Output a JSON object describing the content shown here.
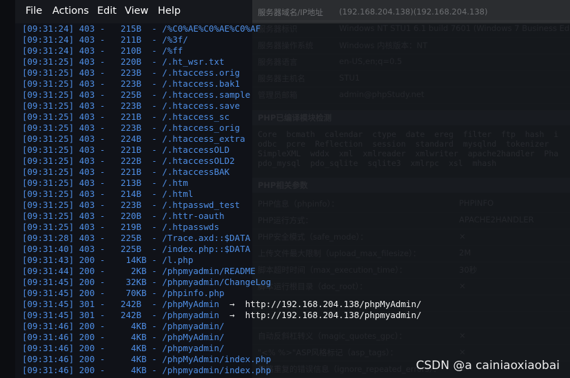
{
  "menu": [
    "File",
    "Actions",
    "Edit",
    "View",
    "Help"
  ],
  "bg_page": {
    "rows": [
      {
        "k": "服务器域名/IP地址",
        "v": "(192.168.204.138)(192.168.204.138)"
      },
      {
        "k": "服务器标识",
        "v": "Windows NT STU1 6.1 build 7601 (Windows 7 Business Edition"
      },
      {
        "k": "服务器操作系统",
        "v": "Windows  内核版本：NT"
      },
      {
        "k": "服务器语言",
        "v": "en-US,en;q=0.5"
      },
      {
        "k": "服务器主机名",
        "v": "STU1"
      },
      {
        "k": "管理员邮箱",
        "v": "admin@phpStudy.net"
      }
    ],
    "section1": "PHP已编译模块检测",
    "modules": "Core  bcmath  calendar  ctype  date  ereg  filter  ftp  hash  i\nodbc  pcre  Reflection  session  standard  mysqlnd  tokenizer  \nSimpleXML  wddx  xml  xmlreader  xmlwriter  apache2handler  Pha\npdo_mysql  pdo_sqlite  sqlite3  xmlrpc  xsl  mhash",
    "section2": "PHP相关参数",
    "params": [
      {
        "k": "PHP信息（phpinfo）：",
        "v": "PHPINFO"
      },
      {
        "k": "PHP运行方式：",
        "v": "APACHE2HANDLER"
      },
      {
        "k": "PHP安全模式（safe_mode）：",
        "v": "×"
      },
      {
        "k": "上传文件最大限制（upload_max_filesize）：",
        "v": "2M"
      },
      {
        "k": "脚本超时时间（max_execution_time）：",
        "v": "30秒"
      },
      {
        "k": "脚本运行根目录（doc_root）：",
        "v": "×"
      },
      {
        "k": "",
        "v": ""
      },
      {
        "k": "",
        "v": ""
      },
      {
        "k": "自动反斜杠转义（magic_quotes_gpc）：",
        "v": "×"
      },
      {
        "k": "\"<% %>\"ASP风格标记（asp_tags）：",
        "v": "×"
      },
      {
        "k": "忽略重复的错误信息（ignore_repeated_errors）：",
        "v": "×"
      }
    ]
  },
  "lines": [
    {
      "t": "[09:31:24] 403 -   215B  - /%C0%AE%C0%AE%C0%AF"
    },
    {
      "t": "[09:31:24] 403 -   211B  - /%3f/"
    },
    {
      "t": "[09:31:24] 403 -   210B  - /%ff"
    },
    {
      "t": "[09:31:25] 403 -   220B  - /.ht_wsr.txt"
    },
    {
      "t": "[09:31:25] 403 -   223B  - /.htaccess.orig"
    },
    {
      "t": "[09:31:25] 403 -   223B  - /.htaccess.bak1"
    },
    {
      "t": "[09:31:25] 403 -   225B  - /.htaccess.sample"
    },
    {
      "t": "[09:31:25] 403 -   223B  - /.htaccess.save"
    },
    {
      "t": "[09:31:25] 403 -   221B  - /.htaccess_sc"
    },
    {
      "t": "[09:31:25] 403 -   223B  - /.htaccess_orig"
    },
    {
      "t": "[09:31:25] 403 -   224B  - /.htaccess_extra"
    },
    {
      "t": "[09:31:25] 403 -   221B  - /.htaccessOLD"
    },
    {
      "t": "[09:31:25] 403 -   222B  - /.htaccessOLD2"
    },
    {
      "t": "[09:31:25] 403 -   221B  - /.htaccessBAK"
    },
    {
      "t": "[09:31:25] 403 -   213B  - /.htm"
    },
    {
      "t": "[09:31:25] 403 -   214B  - /.html"
    },
    {
      "t": "[09:31:25] 403 -   223B  - /.htpasswd_test"
    },
    {
      "t": "[09:31:25] 403 -   220B  - /.httr-oauth"
    },
    {
      "t": "[09:31:25] 403 -   219B  - /.htpasswds"
    },
    {
      "t": "[09:31:28] 403 -   225B  - /Trace.axd::$DATA"
    },
    {
      "t": "[09:31:40] 403 -   225B  - /index.php::$DATA"
    },
    {
      "t": "[09:31:43] 200 -    14KB - /l.php"
    },
    {
      "t": "[09:31:44] 200 -     2KB - /phpmyadmin/README"
    },
    {
      "t": "[09:31:45] 200 -    32KB - /phpmyadmin/ChangeLog"
    },
    {
      "t": "[09:31:45] 200 -    70KB - /phpinfo.php"
    },
    {
      "t": "[09:31:45] 301 -   242B  - /phpMyAdmin",
      "arrow": "→",
      "target": "http://192.168.204.138/phpMyAdmin/"
    },
    {
      "t": "[09:31:45] 301 -   242B  - /phpmyadmin",
      "arrow": "→",
      "target": "http://192.168.204.138/phpmyadmin/"
    },
    {
      "t": "[09:31:46] 200 -     4KB - /phpmyadmin/"
    },
    {
      "t": "[09:31:46] 200 -     4KB - /phpMyAdmin/"
    },
    {
      "t": "[09:31:46] 200 -     4KB - /phpmyadmin/"
    },
    {
      "t": "[09:31:46] 200 -     4KB - /phpMyAdmin/index.php"
    },
    {
      "t": "[09:31:46] 200 -     4KB - /phpmyadmin/index.php"
    }
  ],
  "watermark": "CSDN @a cainiaoxiaobai",
  "colors": {
    "log_text": "#4f8fe6",
    "menu_text": "#ffffff",
    "redirect_text": "#f2f2f2"
  }
}
